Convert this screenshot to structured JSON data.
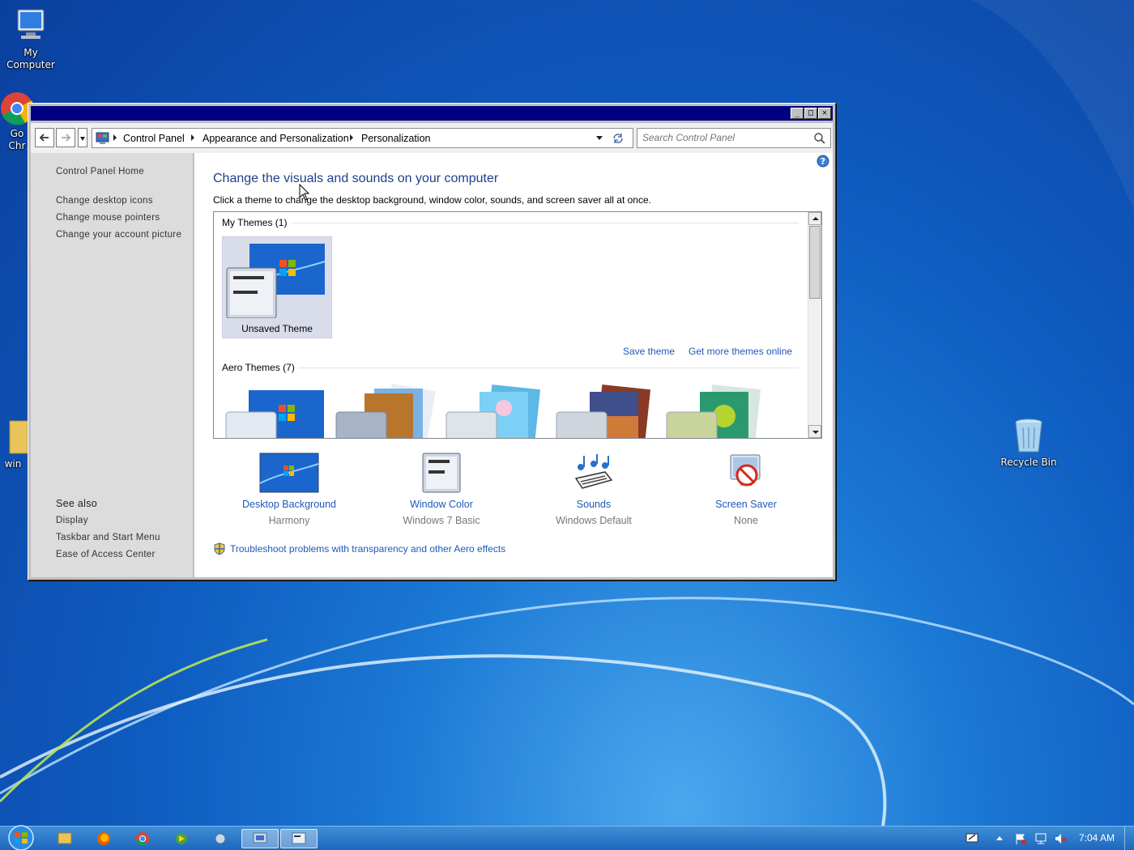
{
  "desktop": {
    "icons": {
      "my_computer": "My\nComputer",
      "chrome": "Go\nChr",
      "folder": "win",
      "recycle_bin": "Recycle Bin"
    }
  },
  "window": {
    "caption_buttons": {
      "minimize": "_",
      "maximize": "□",
      "close": "✕"
    },
    "breadcrumb": [
      "Control Panel",
      "Appearance and Personalization",
      "Personalization"
    ],
    "search": {
      "placeholder": "Search Control Panel"
    },
    "left_pane": {
      "home_link": "Control Panel Home",
      "tasks": [
        "Change desktop icons",
        "Change mouse pointers",
        "Change your account picture"
      ],
      "see_also_heading": "See also",
      "see_also": [
        "Display",
        "Taskbar and Start Menu",
        "Ease of Access Center"
      ]
    },
    "main": {
      "heading": "Change the visuals and sounds on your computer",
      "subtext": "Click a theme to change the desktop background, window color, sounds, and screen saver all at once.",
      "my_themes_label": "My Themes (1)",
      "unsaved_theme_label": "Unsaved Theme",
      "save_theme": "Save theme",
      "get_more_themes": "Get more themes online",
      "aero_themes_label": "Aero Themes (7)",
      "settings": [
        {
          "title": "Desktop Background",
          "value": "Harmony"
        },
        {
          "title": "Window Color",
          "value": "Windows 7 Basic"
        },
        {
          "title": "Sounds",
          "value": "Windows Default"
        },
        {
          "title": "Screen Saver",
          "value": "None"
        }
      ],
      "troubleshoot_link": "Troubleshoot problems with transparency and other Aero effects"
    }
  },
  "taskbar": {
    "clock": "7:04 AM"
  },
  "colors": {
    "link": "#1e5ab8",
    "heading": "#1e3f8a",
    "titlebar": "#000080",
    "taskbar": "#2a74c8"
  }
}
